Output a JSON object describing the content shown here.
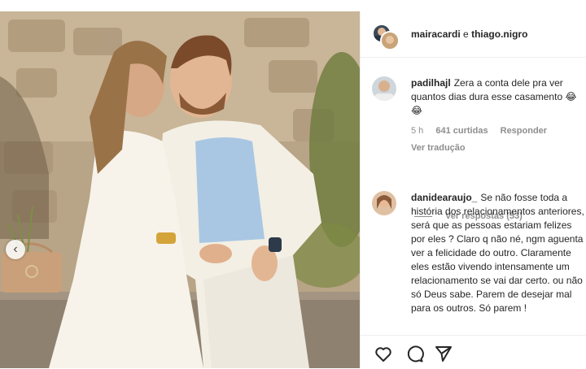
{
  "header": {
    "user1": "mairacardi",
    "conjunction": "e",
    "user2": "thiago.nigro"
  },
  "comments": [
    {
      "username": "padilhajl",
      "text": "Zera a conta dele pra ver quantos dias dura esse casamento 😂😂",
      "time": "5 h",
      "likes": "641 curtidas",
      "reply_label": "Responder",
      "translate_label": "Ver tradução",
      "view_replies": "Ver respostas (53)"
    },
    {
      "username": "danidearaujo_",
      "text": "Se não fosse toda a história dos relacionamentos anteriores, será que as pessoas estariam felizes por eles ? Claro q não né, ngm aguenta ver a felicidade do outro. Claramente eles estão vivendo intensamente um relacionamento se vai dar certo. ou não só Deus sabe. Parem de desejar mal para os outros. Só parem !"
    }
  ],
  "carousel": {
    "prev_icon": "‹"
  },
  "icons": {
    "like": "heart-icon",
    "comment": "comment-icon",
    "share": "send-icon"
  }
}
